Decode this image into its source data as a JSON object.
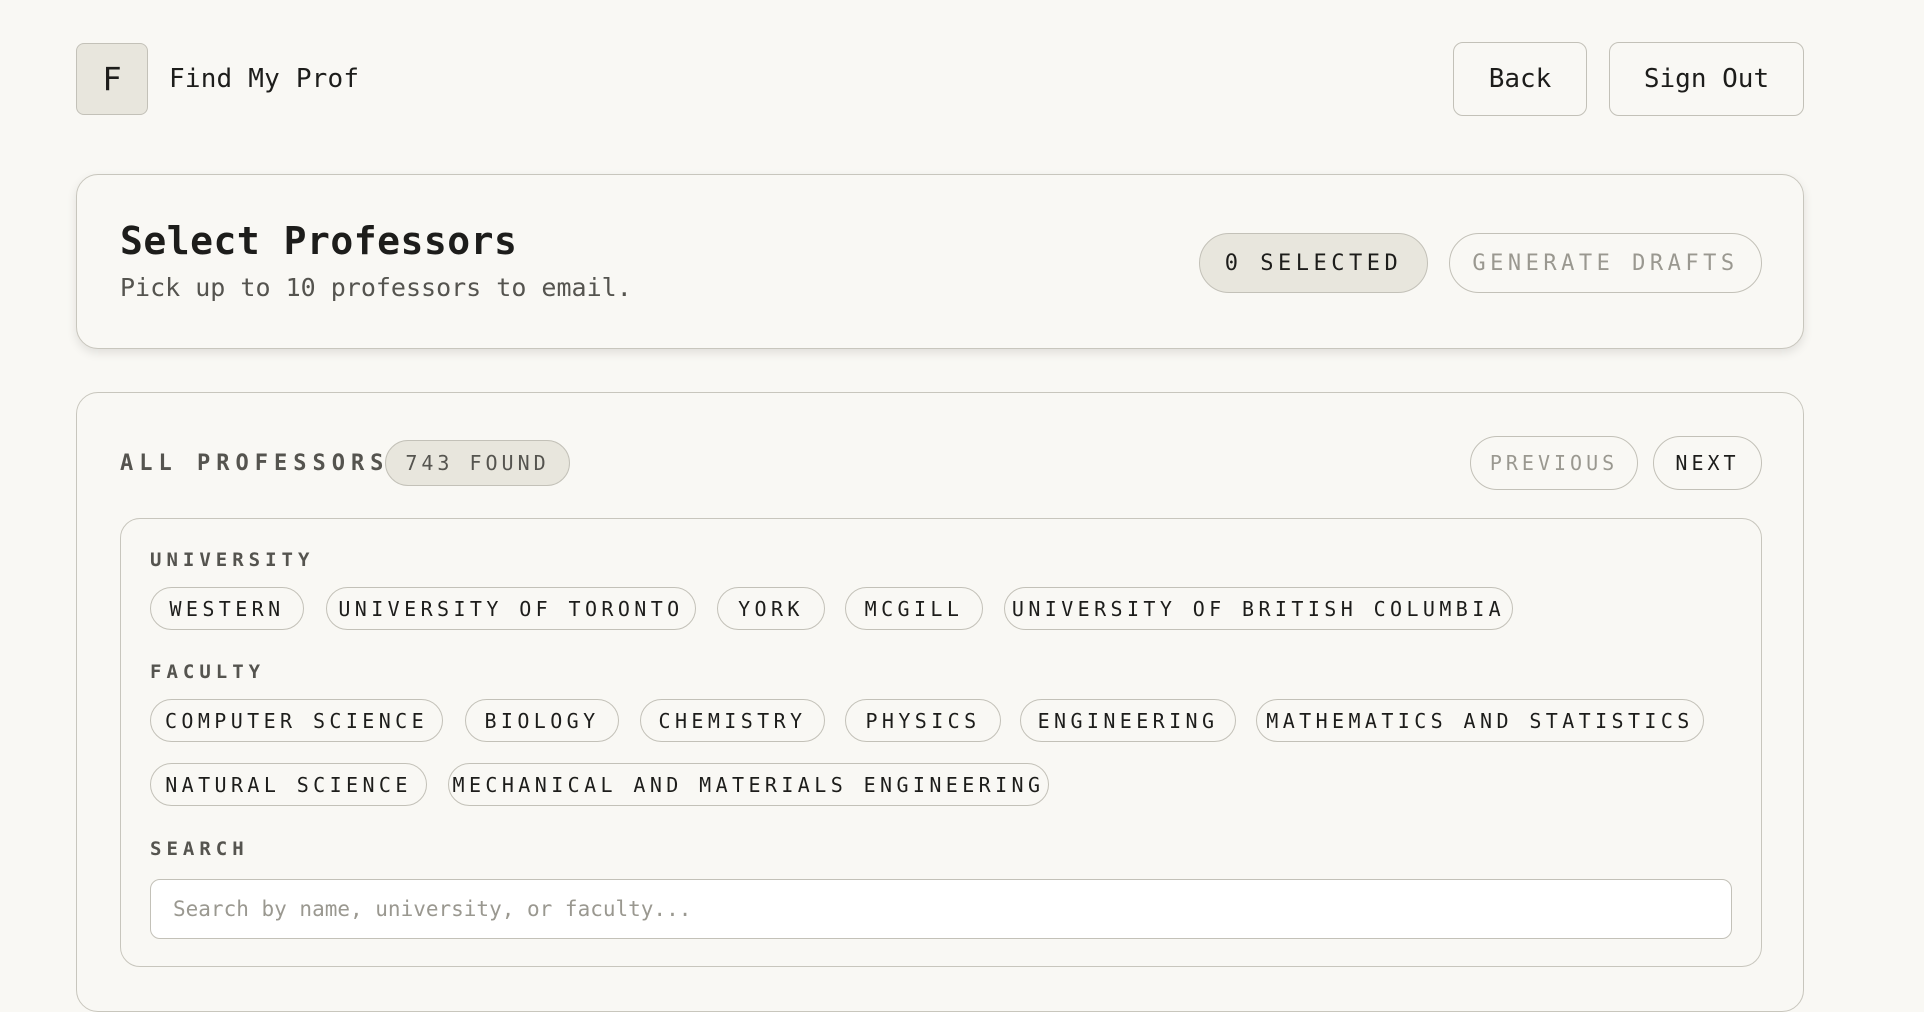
{
  "header": {
    "logo_letter": "F",
    "app_title": "Find My Prof",
    "back_label": "Back",
    "signout_label": "Sign Out"
  },
  "select_panel": {
    "title": "Select Professors",
    "subtitle": "Pick up to 10 professors to email.",
    "selected_badge": "0 SELECTED",
    "generate_label": "GENERATE DRAFTS"
  },
  "professors_panel": {
    "heading": "ALL PROFESSORS",
    "found_badge": "743 FOUND",
    "previous_label": "PREVIOUS",
    "next_label": "NEXT",
    "filters": {
      "university_label": "UNIVERSITY",
      "universities": [
        "WESTERN",
        "UNIVERSITY OF TORONTO",
        "YORK",
        "MCGILL",
        "UNIVERSITY OF BRITISH COLUMBIA"
      ],
      "faculty_label": "FACULTY",
      "faculties": [
        "COMPUTER SCIENCE",
        "BIOLOGY",
        "CHEMISTRY",
        "PHYSICS",
        "ENGINEERING",
        "MATHEMATICS AND STATISTICS",
        "NATURAL SCIENCE",
        "MECHANICAL AND MATERIALS ENGINEERING"
      ],
      "search_label": "SEARCH",
      "search_placeholder": "Search by name, university, or faculty...",
      "search_value": ""
    }
  }
}
